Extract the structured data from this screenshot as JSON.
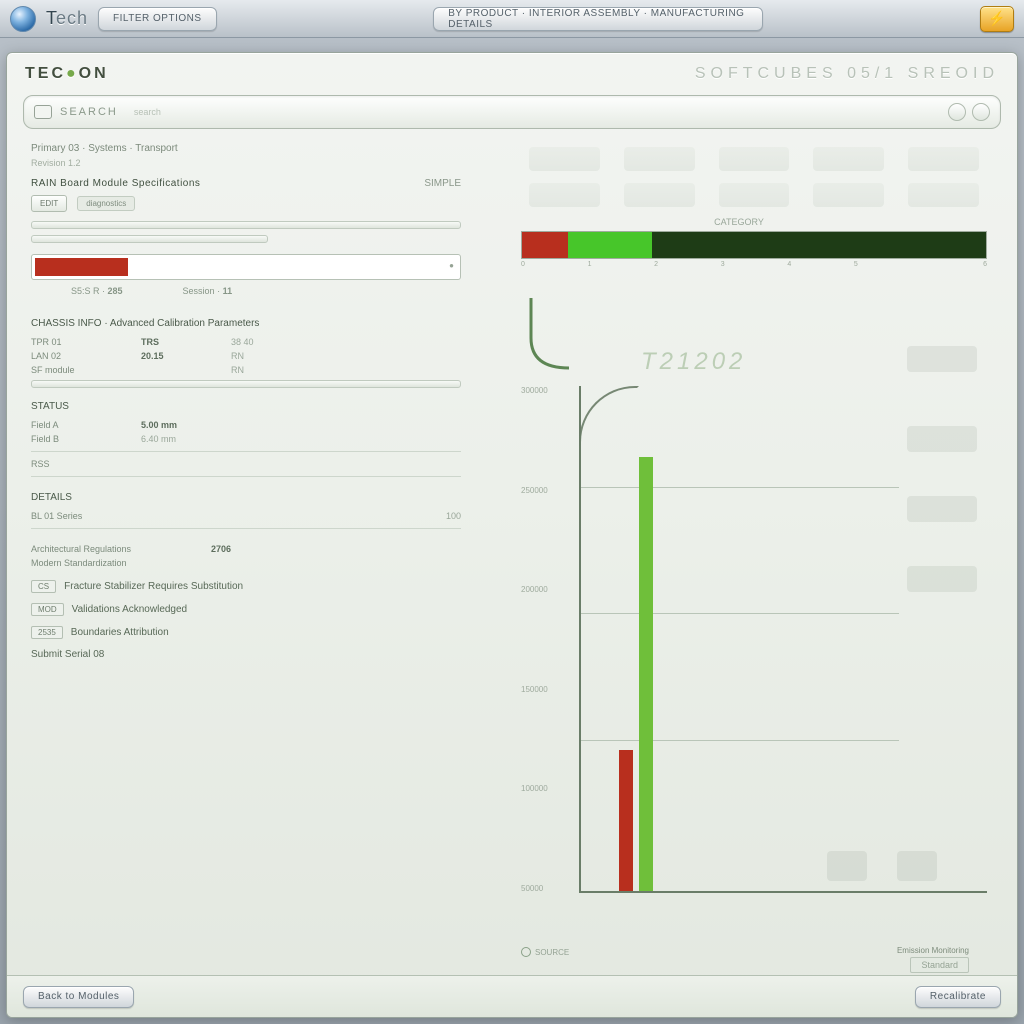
{
  "os": {
    "brand_a": "T",
    "brand_b": "ech",
    "btn_left": "FILTER OPTIONS",
    "btn_center": "BY PRODUCT · INTERIOR ASSEMBLY · MANUFACTURING DETAILS",
    "gold_glyph": "⚡"
  },
  "header": {
    "logo_a": "TEC",
    "logo_b": "ON",
    "title": "SOFTCUBES  05/1  SREOID"
  },
  "search": {
    "label": "SEARCH",
    "hint": "search",
    "ricon_a": "refresh-icon",
    "ricon_b": "info-icon"
  },
  "crumb": {
    "a": "Primary 03 · Systems · Transport",
    "b": "Revision 1.2"
  },
  "section_a": {
    "title": "RAIN  Board Module Specifications",
    "right": "SIMPLE",
    "btn": "EDIT",
    "tag": "diagnostics"
  },
  "progress": {
    "main_pct": 22,
    "pair_a_k": "S5:S R",
    "pair_a_v": "285",
    "pair_b_k": "Session",
    "pair_b_v": "11"
  },
  "section_b": {
    "title": "CHASSIS INFO · Advanced Calibration Parameters",
    "rows": [
      {
        "k": "TPR 01",
        "v": "TRS",
        "x": "38  40"
      },
      {
        "k": "LAN 02",
        "v": "20.15",
        "x": "RN"
      },
      {
        "k": "SF module",
        "v": "",
        "x": "RN"
      }
    ]
  },
  "section_c": {
    "title": "STATUS",
    "rows": [
      {
        "k": "Field A",
        "v": "5.00 mm",
        "x": ""
      },
      {
        "k": "Field B",
        "v": "",
        "x": "6.40 mm"
      },
      {
        "k": "RSS",
        "v": "",
        "x": ""
      }
    ]
  },
  "section_d": {
    "title": "DETAILS",
    "rows": [
      {
        "k": "BL 01  Series",
        "v": "",
        "x": "100"
      }
    ]
  },
  "list": {
    "a_k": "Architectural Regulations",
    "a_v": "2706",
    "b_k": "Modern Standardization",
    "items": [
      {
        "badge": "CS",
        "text": "Fracture Stabilizer Requires Substitution"
      },
      {
        "badge": "MOD",
        "text": "Validations Acknowledged"
      },
      {
        "badge": "2535",
        "text": "Boundaries Attribution"
      },
      {
        "badge": "",
        "text": "Submit Serial 08"
      }
    ]
  },
  "right": {
    "grid_caption": "CATEGORY",
    "gauge_ticks": [
      "0",
      "1",
      "2",
      "3",
      "4",
      "5",
      "6"
    ],
    "gauge_end": "6",
    "watermark": "T21202",
    "legend": "SOURCE",
    "sub_a": "Emission Monitoring",
    "sub_b": "Standard"
  },
  "footer": {
    "left": "Back to Modules",
    "right": "Recalibrate"
  },
  "colors": {
    "red": "#b82f1e",
    "green_bright": "#47c62a",
    "green_dark": "#1e3c16"
  },
  "chart_data": [
    {
      "type": "bar",
      "title": "Horizontal status gauge",
      "orientation": "horizontal_stacked",
      "xlim": [
        0,
        6
      ],
      "segments": [
        {
          "name": "red",
          "value": 0.6,
          "color": "#b82f1e"
        },
        {
          "name": "green_bright",
          "value": 1.1,
          "color": "#47c62a"
        },
        {
          "name": "green_dark",
          "value": 4.3,
          "color": "#1e3c16"
        }
      ]
    },
    {
      "type": "bar",
      "title": "T21202",
      "ylim": [
        0,
        300000
      ],
      "y_ticks": [
        50000,
        100000,
        150000,
        200000,
        250000,
        300000
      ],
      "series": [
        {
          "name": "red",
          "x": 0,
          "value": 85000,
          "color": "#b82f1e"
        },
        {
          "name": "green",
          "x": 1,
          "value": 260000,
          "color": "#6fbf3a"
        }
      ]
    }
  ]
}
